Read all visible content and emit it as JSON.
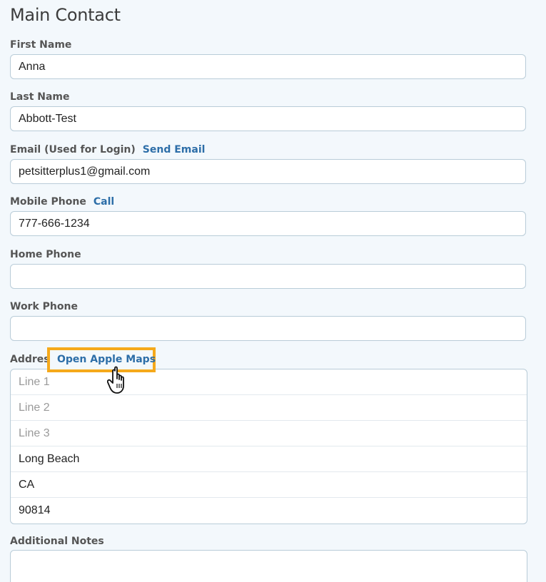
{
  "section_title": "Main Contact",
  "first_name": {
    "label": "First Name",
    "value": "Anna"
  },
  "last_name": {
    "label": "Last Name",
    "value": "Abbott-Test"
  },
  "email": {
    "label": "Email (Used for Login)",
    "link": "Send Email",
    "value": "petsitterplus1@gmail.com"
  },
  "mobile_phone": {
    "label": "Mobile Phone",
    "link": "Call",
    "value": "777-666-1234"
  },
  "home_phone": {
    "label": "Home Phone",
    "value": ""
  },
  "work_phone": {
    "label": "Work Phone",
    "value": ""
  },
  "address": {
    "label": "Address",
    "link": "Open Apple Maps",
    "line1_placeholder": "Line 1",
    "line2_placeholder": "Line 2",
    "line3_placeholder": "Line 3",
    "city": "Long Beach",
    "state": "CA",
    "zip": "90814"
  },
  "notes": {
    "label": "Additional Notes",
    "value": ""
  },
  "colors": {
    "link": "#2d6ea8",
    "highlight": "#f5a91b",
    "background": "#f3f8fc"
  },
  "icons": {
    "cursor": "hand-pointer-icon"
  }
}
